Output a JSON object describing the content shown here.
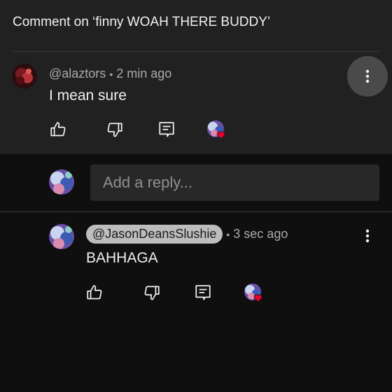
{
  "header": {
    "title": "Comment on ‘finny WOAH THERE BUDDY’"
  },
  "comment": {
    "author": "@alaztors",
    "separator": "•",
    "time": "2 min ago",
    "text": "I mean sure",
    "actions": [
      "like-icon",
      "dislike-icon",
      "reply-icon",
      "creator-heart-icon"
    ]
  },
  "reply_box": {
    "placeholder": "Add a reply..."
  },
  "reply": {
    "author": "@JasonDeansSlushie",
    "separator": "•",
    "time": "3 sec ago",
    "text": "BAHHAGA",
    "actions": [
      "like-icon",
      "dislike-icon",
      "reply-icon",
      "creator-heart-icon"
    ]
  },
  "colors": {
    "panel": "#212121",
    "background": "#0f0f0f",
    "heart": "#e8002d",
    "mention_chip": "#bdbdbd"
  }
}
